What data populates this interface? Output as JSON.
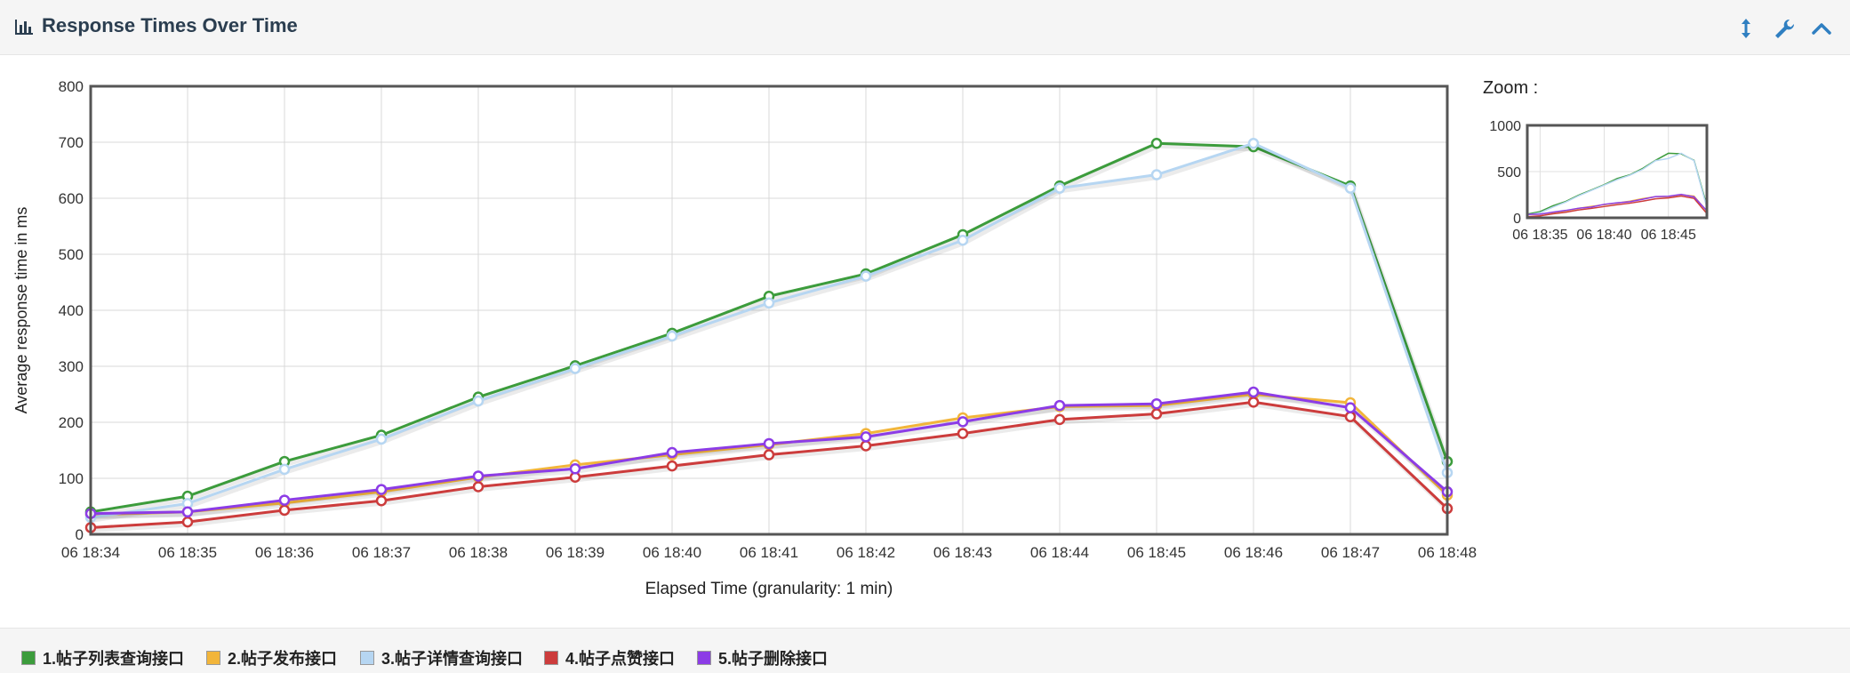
{
  "header": {
    "title": "Response Times Over Time",
    "icons": [
      "bar-chart-icon",
      "resize-vertical-icon",
      "wrench-icon",
      "chevron-up-icon"
    ]
  },
  "zoom": {
    "label": "Zoom :"
  },
  "chart_data": {
    "type": "line",
    "title": "Response Times Over Time",
    "xlabel": "Elapsed Time (granularity: 1 min)",
    "ylabel": "Average response time in ms",
    "x": [
      "06 18:34",
      "06 18:35",
      "06 18:36",
      "06 18:37",
      "06 18:38",
      "06 18:39",
      "06 18:40",
      "06 18:41",
      "06 18:42",
      "06 18:43",
      "06 18:44",
      "06 18:45",
      "06 18:46",
      "06 18:47",
      "06 18:48"
    ],
    "ylim": [
      0,
      800
    ],
    "yticks": [
      0,
      100,
      200,
      300,
      400,
      500,
      600,
      700,
      800
    ],
    "grid": true,
    "legend_position": "bottom",
    "series": [
      {
        "name": "1.帖子列表查询接口",
        "color": "#3c9c3c",
        "values": [
          40,
          68,
          130,
          177,
          245,
          301,
          359,
          425,
          465,
          535,
          622,
          698,
          692,
          622,
          130
        ]
      },
      {
        "name": "2.帖子发布接口",
        "color": "#f2b53a",
        "values": [
          35,
          40,
          56,
          76,
          102,
          124,
          142,
          160,
          180,
          208,
          228,
          230,
          250,
          235,
          70
        ]
      },
      {
        "name": "3.帖子详情查询接口",
        "color": "#b6d6f2",
        "values": [
          30,
          55,
          116,
          170,
          238,
          296,
          354,
          413,
          461,
          525,
          618,
          642,
          698,
          618,
          110
        ]
      },
      {
        "name": "4.帖子点赞接口",
        "color": "#cc3c3c",
        "values": [
          12,
          22,
          43,
          60,
          85,
          102,
          122,
          142,
          158,
          180,
          205,
          215,
          236,
          210,
          46
        ]
      },
      {
        "name": "5.帖子删除接口",
        "color": "#8c3ce6",
        "values": [
          37,
          40,
          61,
          80,
          104,
          117,
          146,
          162,
          174,
          201,
          230,
          233,
          254,
          226,
          76
        ]
      }
    ],
    "overview": {
      "ylim": [
        0,
        1000
      ],
      "yticks": [
        0,
        500,
        1000
      ],
      "xticks": [
        "06 18:35",
        "06 18:40",
        "06 18:45"
      ]
    }
  }
}
